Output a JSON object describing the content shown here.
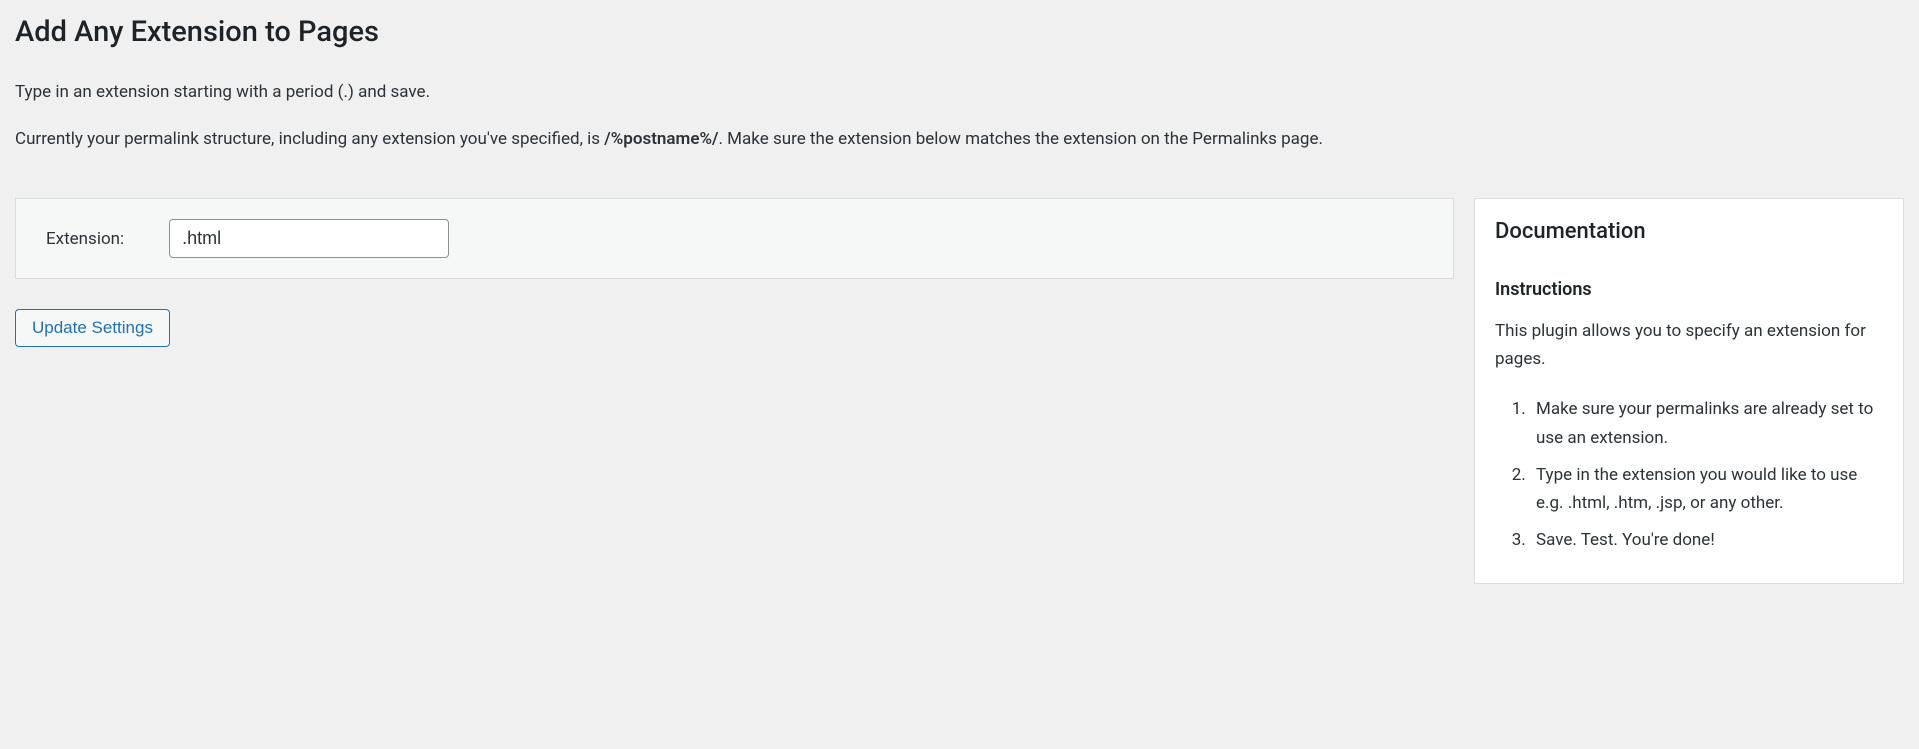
{
  "header": {
    "title": "Add Any Extension to Pages"
  },
  "intro": {
    "line1": "Type in an extension starting with a period (.) and save.",
    "line2_prefix": "Currently your permalink structure, including any extension you've specified, is ",
    "line2_structure": "/%postname%/",
    "line2_suffix": ". Make sure the extension below matches the extension on the Permalinks page."
  },
  "form": {
    "label": "Extension:",
    "value": ".html",
    "submit_label": "Update Settings"
  },
  "docs": {
    "title": "Documentation",
    "subtitle": "Instructions",
    "description": "This plugin allows you to specify an extension for pages.",
    "steps": [
      "Make sure your permalinks are already set to use an extension.",
      "Type in the extension you would like to use e.g. .html, .htm, .jsp, or any other.",
      "Save. Test. You're done!"
    ]
  }
}
